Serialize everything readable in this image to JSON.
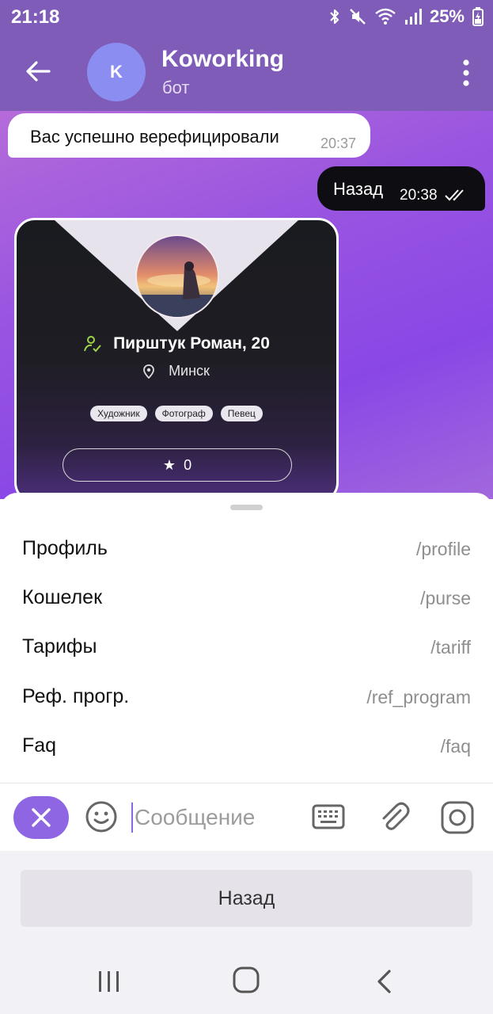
{
  "status_bar": {
    "time": "21:18",
    "battery": "25%",
    "icons": [
      "bluetooth-icon",
      "mute-icon",
      "wifi-icon",
      "signal-icon",
      "battery-charging-icon"
    ]
  },
  "header": {
    "avatar_letter": "K",
    "title": "Koworking",
    "subtitle": "бот",
    "colors": {
      "header_bg": "#7e5cb8",
      "avatar_bg": "#8b8ef0"
    }
  },
  "messages": [
    {
      "direction": "incoming",
      "text": "Вас успешно верефицировали",
      "time": "20:37"
    },
    {
      "direction": "outgoing",
      "text": "Назад",
      "time": "20:38",
      "status": "read"
    }
  ],
  "profile_card": {
    "name": "Пирштук Роман, 20",
    "city": "Минск",
    "tags": [
      "Художник",
      "Фотограф",
      "Певец"
    ],
    "rating": "0"
  },
  "commands": [
    {
      "label": "Профиль",
      "command": "/profile"
    },
    {
      "label": "Кошелек",
      "command": "/purse"
    },
    {
      "label": "Тарифы",
      "command": "/tariff"
    },
    {
      "label": "Реф. прогр.",
      "command": "/ref_program"
    },
    {
      "label": "Faq",
      "command": "/faq"
    }
  ],
  "input": {
    "placeholder": "Сообщение",
    "value": ""
  },
  "reply_keyboard": {
    "button_label": "Назад"
  },
  "accent_color": "#8e66e4"
}
